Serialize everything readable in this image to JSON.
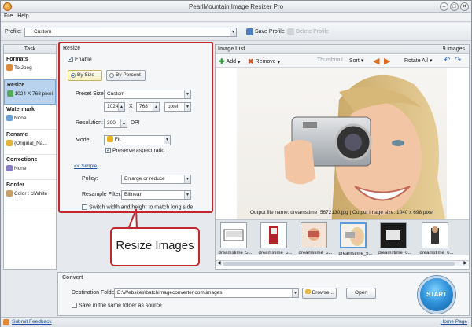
{
  "window": {
    "title": "PearlMountain Image Resizer Pro",
    "controls": [
      "–",
      "□",
      "✕"
    ]
  },
  "menu": [
    "File",
    "Help"
  ],
  "profile": {
    "label": "Profile:",
    "value": "Custom",
    "save": "Save Profile",
    "delete": "Delete Profile"
  },
  "tasks": {
    "header": "Task",
    "items": [
      {
        "title": "Formats",
        "value": "To Jpeg",
        "icon": "jpeg-icon",
        "color": "#e0893a"
      },
      {
        "title": "Resize",
        "value": "1024 X 768 pixel",
        "icon": "resize-icon",
        "color": "#5aa85a"
      },
      {
        "title": "Watermark",
        "value": "None",
        "icon": "watermark-icon",
        "color": "#6aa0d8"
      },
      {
        "title": "Rename",
        "value": "{Original_Na...",
        "icon": "pencil-icon",
        "color": "#e5b33a"
      },
      {
        "title": "Corrections",
        "value": "None",
        "icon": "corrections-icon",
        "color": "#8a7ec8"
      },
      {
        "title": "Border",
        "value": "Color : clWhite",
        "value2": "....",
        "icon": "border-icon",
        "color": "#c9a06a"
      }
    ]
  },
  "resize": {
    "header": "Resize",
    "enable": "Enable",
    "by_size": "By Size",
    "by_percent": "By Percent",
    "preset_label": "Preset Size:",
    "preset_value": "Custom",
    "width": "1024",
    "x": "X",
    "height": "768",
    "unit": "pixel",
    "resolution_label": "Resolution:",
    "resolution_value": "300",
    "dpi": "DPI",
    "mode_label": "Mode:",
    "mode_value": "Fit",
    "preserve": "Preserve aspect ratio",
    "simple": "<< Simple",
    "policy_label": "Policy:",
    "policy_value": "Enlarge or reduce",
    "filter_label": "Resample Filter:",
    "filter_value": "Bilinear",
    "switch": "Switch width and height to match long side"
  },
  "callout": "Resize Images",
  "image_list": {
    "header": "Image List",
    "count": "9 images",
    "add": "Add",
    "remove": "Remove",
    "thumbnail": "Thumbnail",
    "sort": "Sort",
    "rotate": "Rotate All",
    "output_info": "Output file name: dreamstime_5672130.jpg | Output image size: 1040 x 698 pixel",
    "thumbs": [
      "dreamstime_5...",
      "dreamstime_5...",
      "dreamstime_5...",
      "dreamstime_5...",
      "dreamstime_6...",
      "dreamstime_6..."
    ]
  },
  "convert": {
    "header": "Convert",
    "dest_label": "Destination Folder:",
    "dest_value": "E:\\Websites\\batchimageconverter.com\\images",
    "browse": "Browse...",
    "open": "Open",
    "same_folder": "Save in the same folder as source",
    "start": "START"
  },
  "status": {
    "feedback": "Submit Feedback",
    "home": "Home Page"
  }
}
